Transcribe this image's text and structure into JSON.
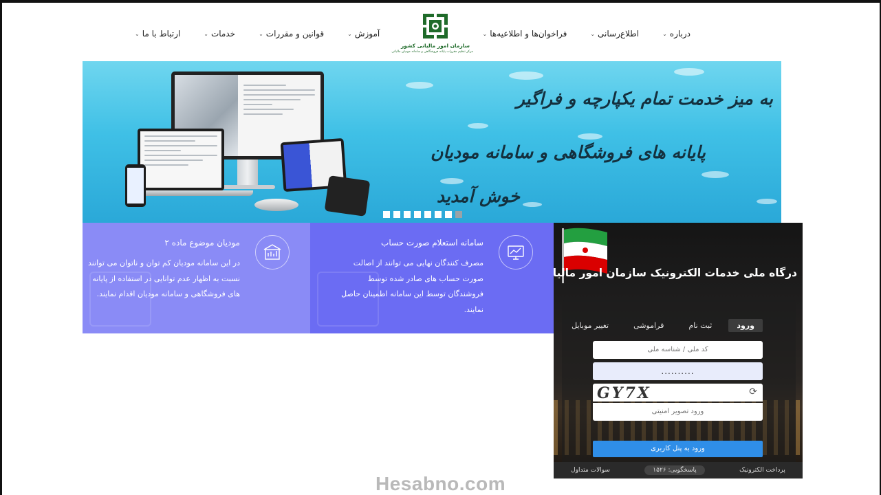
{
  "nav": {
    "right": [
      {
        "label": "درباره"
      },
      {
        "label": "اطلاع‌رسانی"
      },
      {
        "label": "فراخوان‌ها و اطلاعیه‌ها"
      }
    ],
    "left": [
      {
        "label": "آموزش"
      },
      {
        "label": "قوانین و مقررات"
      },
      {
        "label": "خدمات"
      },
      {
        "label": "ارتباط با ما"
      }
    ]
  },
  "logo": {
    "title": "سازمان امور مالیاتی کشور",
    "subtitle": "مرکز تنظیم مقررات پایانه فروشگاهی و سامانه مودیان مالیاتی",
    "icon": "tax-organization-emblem"
  },
  "banner": {
    "line1": "به میز خدمت تمام یکپارچه و فراگیر",
    "line2": "پایانه های فروشگاهی و سامانه مودیان",
    "line3": "خوش آمدید",
    "slide_count": 8,
    "active_slide": 8
  },
  "cards": [
    {
      "title": "مودیان موضوع ماده ۲",
      "body": "در این سامانه مودیان کم توان و ناتوان می توانند نسبت به اظهار عدم توانایی در استفاده از پایانه های فروشگاهی و سامانه مودیان اقدام نمایند.",
      "icon": "building-chart-icon",
      "color": "#8a8bf6"
    },
    {
      "title": "سامانه استعلام صورت حساب",
      "body": "مصرف کنندگان نهایی می توانند از اصالت صورت حساب های صادر شده توسط فروشندگان توسط این سامانه اطمینان حاصل نمایند.",
      "icon": "monitor-chart-icon",
      "color": "#6b6cf3"
    }
  ],
  "login": {
    "title": "درگاه ملی خدمات الکترونیک سازمان امور مالیاتی",
    "tabs": [
      {
        "label": "ورود",
        "active": true
      },
      {
        "label": "ثبت نام",
        "active": false
      },
      {
        "label": "فراموشی",
        "active": false
      },
      {
        "label": "تغییر موبایل",
        "active": false
      }
    ],
    "username_placeholder": "کد ملی / شناسه ملی",
    "password_value": "..........",
    "captcha_text": "GY7X",
    "captcha_placeholder": "ورود تصویر امنیتی",
    "submit_label": "ورود به پنل کاربری",
    "footer": {
      "payment": "پرداخت الکترونیک",
      "phone": "پاسخگویی: ۱۵۲۶",
      "faq": "سوالات متداول"
    }
  },
  "watermark": "Hesabno.com"
}
